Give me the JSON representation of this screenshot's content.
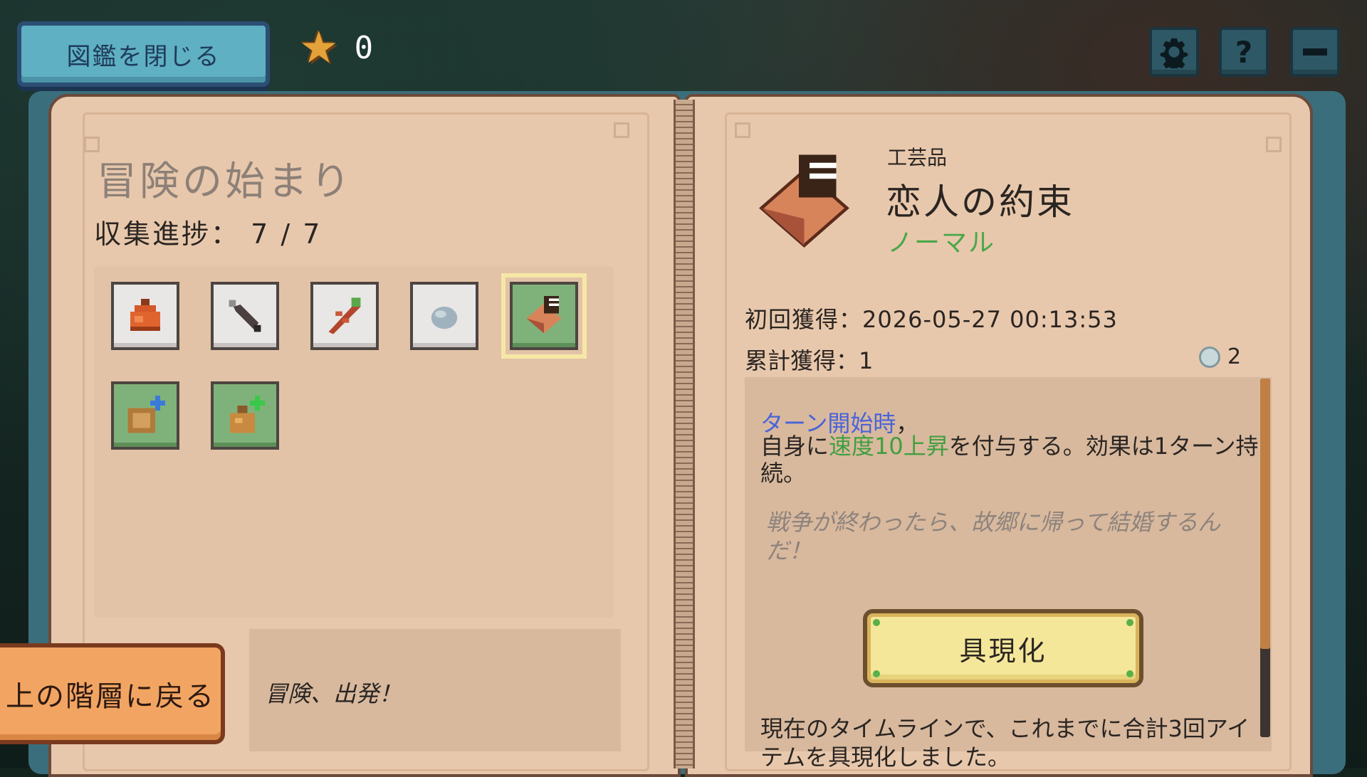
{
  "header": {
    "close_label": "図鑑を閉じる",
    "star_count": "0",
    "settings_icon": "gear-icon",
    "help_icon": "question-icon",
    "minimize_icon": "minus-icon"
  },
  "left_page": {
    "title": "冒険の始まり",
    "progress": "収集進捗： 7 / 7",
    "items": [
      {
        "icon": "orange-pouch-icon"
      },
      {
        "icon": "kunai-icon"
      },
      {
        "icon": "red-herb-icon"
      },
      {
        "icon": "stone-icon"
      },
      {
        "icon": "lovers-promise-icon"
      },
      {
        "icon": "bag-plus-blue-icon"
      },
      {
        "icon": "pouch-plus-green-icon"
      }
    ],
    "back_label": "上の階層に戻る",
    "quote": "冒険、出発！"
  },
  "right_page": {
    "category": "工芸品",
    "name": "恋人の約束",
    "rarity": "ノーマル",
    "first_obtained": "初回獲得：2026-05-27 00:13:53",
    "total_obtained": "累計獲得：1",
    "points": "2",
    "effect_trigger": "ターン開始時",
    "effect_line_pre": "自身に",
    "effect_highlight": "速度10上昇",
    "effect_line_post": "を付与する。効果は1ターン持続。",
    "flavor": "戦争が終わったら、故郷に帰って結婚するんだ！",
    "manifest_label": "具現化",
    "footer": "現在のタイムラインで、これまでに合計3回アイテムを具現化しました。"
  },
  "colors": {
    "page": "#e8c8ac",
    "trigger_blue": "#4a63d8",
    "highlight_green": "#3f9f3f",
    "rarity_green": "#4aa84a"
  }
}
